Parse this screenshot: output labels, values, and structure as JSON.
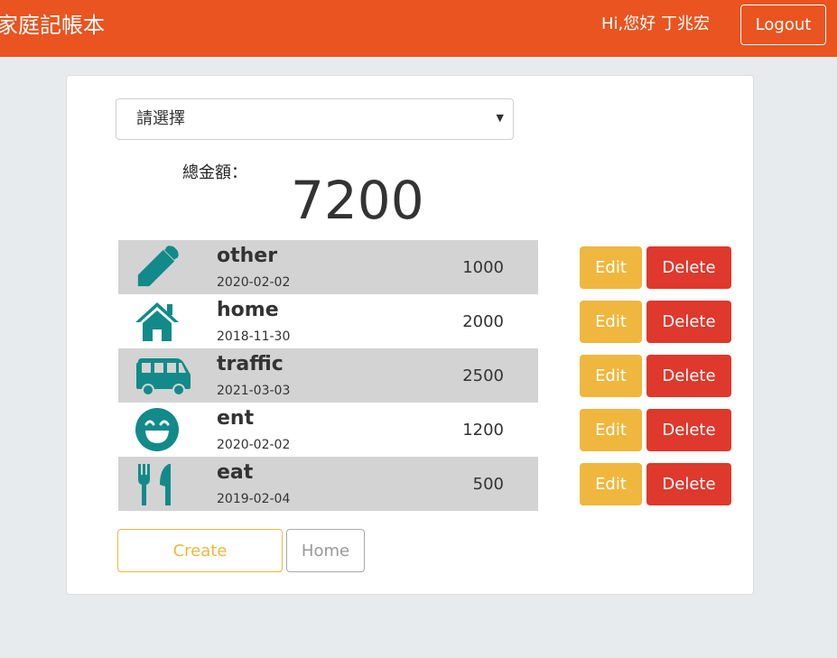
{
  "navbar": {
    "brand": "家庭記帳本",
    "greeting": "Hi,您好 丁兆宏",
    "logout_label": "Logout"
  },
  "filter": {
    "selected": "請選擇"
  },
  "summary": {
    "label": "總金額：",
    "total": "7200"
  },
  "records": [
    {
      "icon": "pencil-icon",
      "name": "other",
      "date": "2020-02-02",
      "amount": "1000"
    },
    {
      "icon": "home-icon",
      "name": "home",
      "date": "2018-11-30",
      "amount": "2000"
    },
    {
      "icon": "van-icon",
      "name": "traffic",
      "date": "2021-03-03",
      "amount": "2500"
    },
    {
      "icon": "smile-icon",
      "name": "ent",
      "date": "2020-02-02",
      "amount": "1200"
    },
    {
      "icon": "utensils-icon",
      "name": "eat",
      "date": "2019-02-04",
      "amount": "500"
    }
  ],
  "row_actions": {
    "edit_label": "Edit",
    "delete_label": "Delete"
  },
  "footer": {
    "create_label": "Create",
    "home_label": "Home"
  },
  "colors": {
    "brand": "#e95420",
    "icon": "#128a8a",
    "edit": "#efb73e",
    "delete": "#df382c",
    "row_shade": "#d3d3d3"
  }
}
